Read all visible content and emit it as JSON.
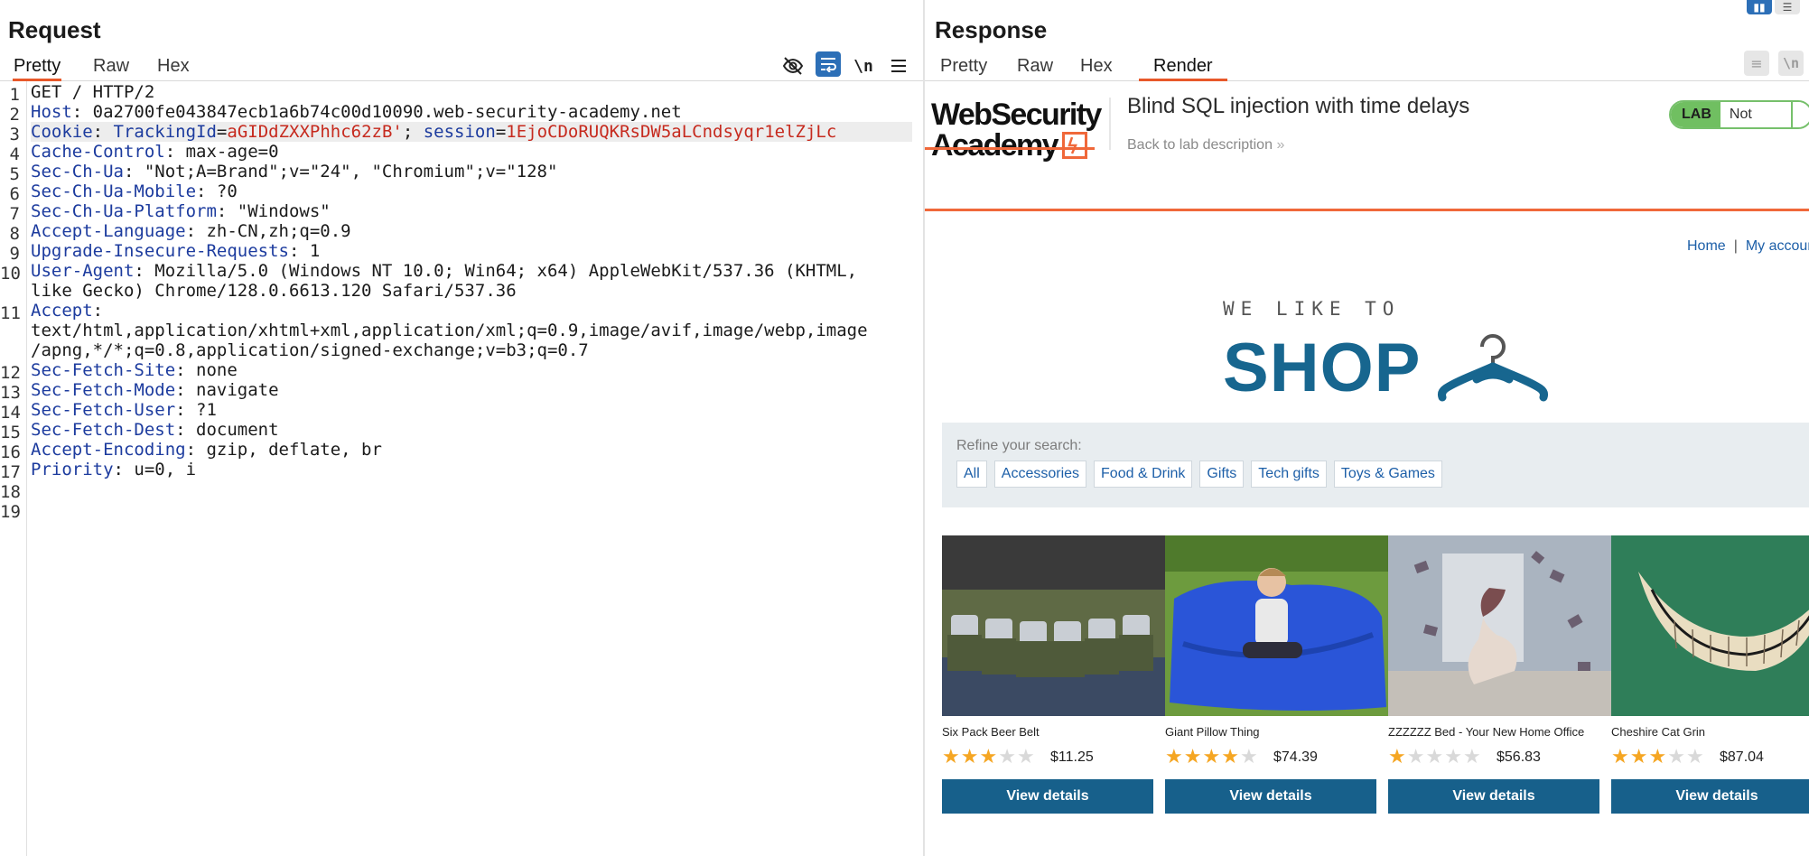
{
  "request": {
    "title": "Request",
    "tabs": [
      "Pretty",
      "Raw",
      "Hex"
    ],
    "toolbar": {
      "hide_icon": "eye-off",
      "wrap_icon": "wrap",
      "newline_label": "\\n",
      "menu_icon": "hamburger"
    },
    "lines": [
      {
        "n": "1",
        "parts": [
          {
            "c": "v",
            "t": "GET / HTTP/2"
          }
        ]
      },
      {
        "n": "2",
        "parts": [
          {
            "c": "k",
            "t": "Host"
          },
          {
            "c": "v",
            "t": ": 0a2700fe043847ecb1a6b74c00d10090.web-security-academy.net"
          }
        ]
      },
      {
        "n": "3",
        "hl": true,
        "parts": [
          {
            "c": "k",
            "t": "Cookie"
          },
          {
            "c": "v",
            "t": ": "
          },
          {
            "c": "k",
            "t": "TrackingId"
          },
          {
            "c": "v",
            "t": "="
          },
          {
            "c": "r",
            "t": "aGIDdZXXPhhc62zB'"
          },
          {
            "c": "v",
            "t": "; "
          },
          {
            "c": "k",
            "t": "session"
          },
          {
            "c": "v",
            "t": "="
          },
          {
            "c": "r",
            "t": "1EjoCDoRUQKRsDW5aLCndsyqr1elZjLc"
          }
        ]
      },
      {
        "n": "4",
        "parts": [
          {
            "c": "k",
            "t": "Cache-Control"
          },
          {
            "c": "v",
            "t": ": max-age=0"
          }
        ]
      },
      {
        "n": "5",
        "parts": [
          {
            "c": "k",
            "t": "Sec-Ch-Ua"
          },
          {
            "c": "v",
            "t": ": \"Not;A=Brand\";v=\"24\", \"Chromium\";v=\"128\""
          }
        ]
      },
      {
        "n": "6",
        "parts": [
          {
            "c": "k",
            "t": "Sec-Ch-Ua-Mobile"
          },
          {
            "c": "v",
            "t": ": ?0"
          }
        ]
      },
      {
        "n": "7",
        "parts": [
          {
            "c": "k",
            "t": "Sec-Ch-Ua-Platform"
          },
          {
            "c": "v",
            "t": ": \"Windows\""
          }
        ]
      },
      {
        "n": "8",
        "parts": [
          {
            "c": "k",
            "t": "Accept-Language"
          },
          {
            "c": "v",
            "t": ": zh-CN,zh;q=0.9"
          }
        ]
      },
      {
        "n": "9",
        "parts": [
          {
            "c": "k",
            "t": "Upgrade-Insecure-Requests"
          },
          {
            "c": "v",
            "t": ": 1"
          }
        ]
      },
      {
        "n": "10",
        "parts": [
          {
            "c": "k",
            "t": "User-Agent"
          },
          {
            "c": "v",
            "t": ": Mozilla/5.0 (Windows NT 10.0; Win64; x64) AppleWebKit/537.36 (KHTML,"
          }
        ]
      },
      {
        "n": "",
        "parts": [
          {
            "c": "v",
            "t": "like Gecko) Chrome/128.0.6613.120 Safari/537.36"
          }
        ]
      },
      {
        "n": "11",
        "parts": [
          {
            "c": "k",
            "t": "Accept"
          },
          {
            "c": "v",
            "t": ":"
          }
        ]
      },
      {
        "n": "",
        "parts": [
          {
            "c": "v",
            "t": "text/html,application/xhtml+xml,application/xml;q=0.9,image/avif,image/webp,image"
          }
        ]
      },
      {
        "n": "",
        "parts": [
          {
            "c": "v",
            "t": "/apng,*/*;q=0.8,application/signed-exchange;v=b3;q=0.7"
          }
        ]
      },
      {
        "n": "12",
        "parts": [
          {
            "c": "k",
            "t": "Sec-Fetch-Site"
          },
          {
            "c": "v",
            "t": ": none"
          }
        ]
      },
      {
        "n": "13",
        "parts": [
          {
            "c": "k",
            "t": "Sec-Fetch-Mode"
          },
          {
            "c": "v",
            "t": ": navigate"
          }
        ]
      },
      {
        "n": "14",
        "parts": [
          {
            "c": "k",
            "t": "Sec-Fetch-User"
          },
          {
            "c": "v",
            "t": ": ?1"
          }
        ]
      },
      {
        "n": "15",
        "parts": [
          {
            "c": "k",
            "t": "Sec-Fetch-Dest"
          },
          {
            "c": "v",
            "t": ": document"
          }
        ]
      },
      {
        "n": "16",
        "parts": [
          {
            "c": "k",
            "t": "Accept-Encoding"
          },
          {
            "c": "v",
            "t": ": gzip, deflate, br"
          }
        ]
      },
      {
        "n": "17",
        "parts": [
          {
            "c": "k",
            "t": "Priority"
          },
          {
            "c": "v",
            "t": ": u=0, i"
          }
        ]
      },
      {
        "n": "18",
        "parts": []
      },
      {
        "n": "19",
        "parts": []
      }
    ]
  },
  "response": {
    "title": "Response",
    "tabs": [
      "Pretty",
      "Raw",
      "Hex",
      "Render"
    ],
    "active_tab": "Render",
    "toolbar": {
      "wrap_icon": "wrap",
      "newline_label": "\\n"
    },
    "render": {
      "logo_line1": "WebSecurity",
      "logo_line2": "Academy",
      "lab_title": "Blind SQL injection with time delays",
      "back_link": "Back to lab description",
      "back_arrow": "»",
      "badge_lab": "LAB",
      "badge_status": "Not solved",
      "nav_home": "Home",
      "nav_sep": "|",
      "nav_account": "My account",
      "shop_small": "WE LIKE TO",
      "shop_big": "SHOP",
      "search_label": "Refine your search:",
      "filters": [
        "All",
        "Accessories",
        "Food & Drink",
        "Gifts",
        "Tech gifts",
        "Toys & Games"
      ],
      "products": [
        {
          "name": "Six Pack Beer Belt",
          "rating": 3,
          "price": "$11.25",
          "button": "View details"
        },
        {
          "name": "Giant Pillow Thing",
          "rating": 4,
          "price": "$74.39",
          "button": "View details"
        },
        {
          "name": "ZZZZZZ Bed - Your New Home Office",
          "rating": 1,
          "price": "$56.83",
          "button": "View details"
        },
        {
          "name": "Cheshire Cat Grin",
          "rating": 3,
          "price": "$87.04",
          "button": "View details"
        }
      ]
    }
  },
  "colors": {
    "accent_orange": "#e8582a",
    "header_key_blue": "#1c3b9e",
    "cookie_value_red": "#c62a1e",
    "shop_blue": "#17668f",
    "button_blue": "#17608b",
    "lab_green": "#70bf61"
  }
}
